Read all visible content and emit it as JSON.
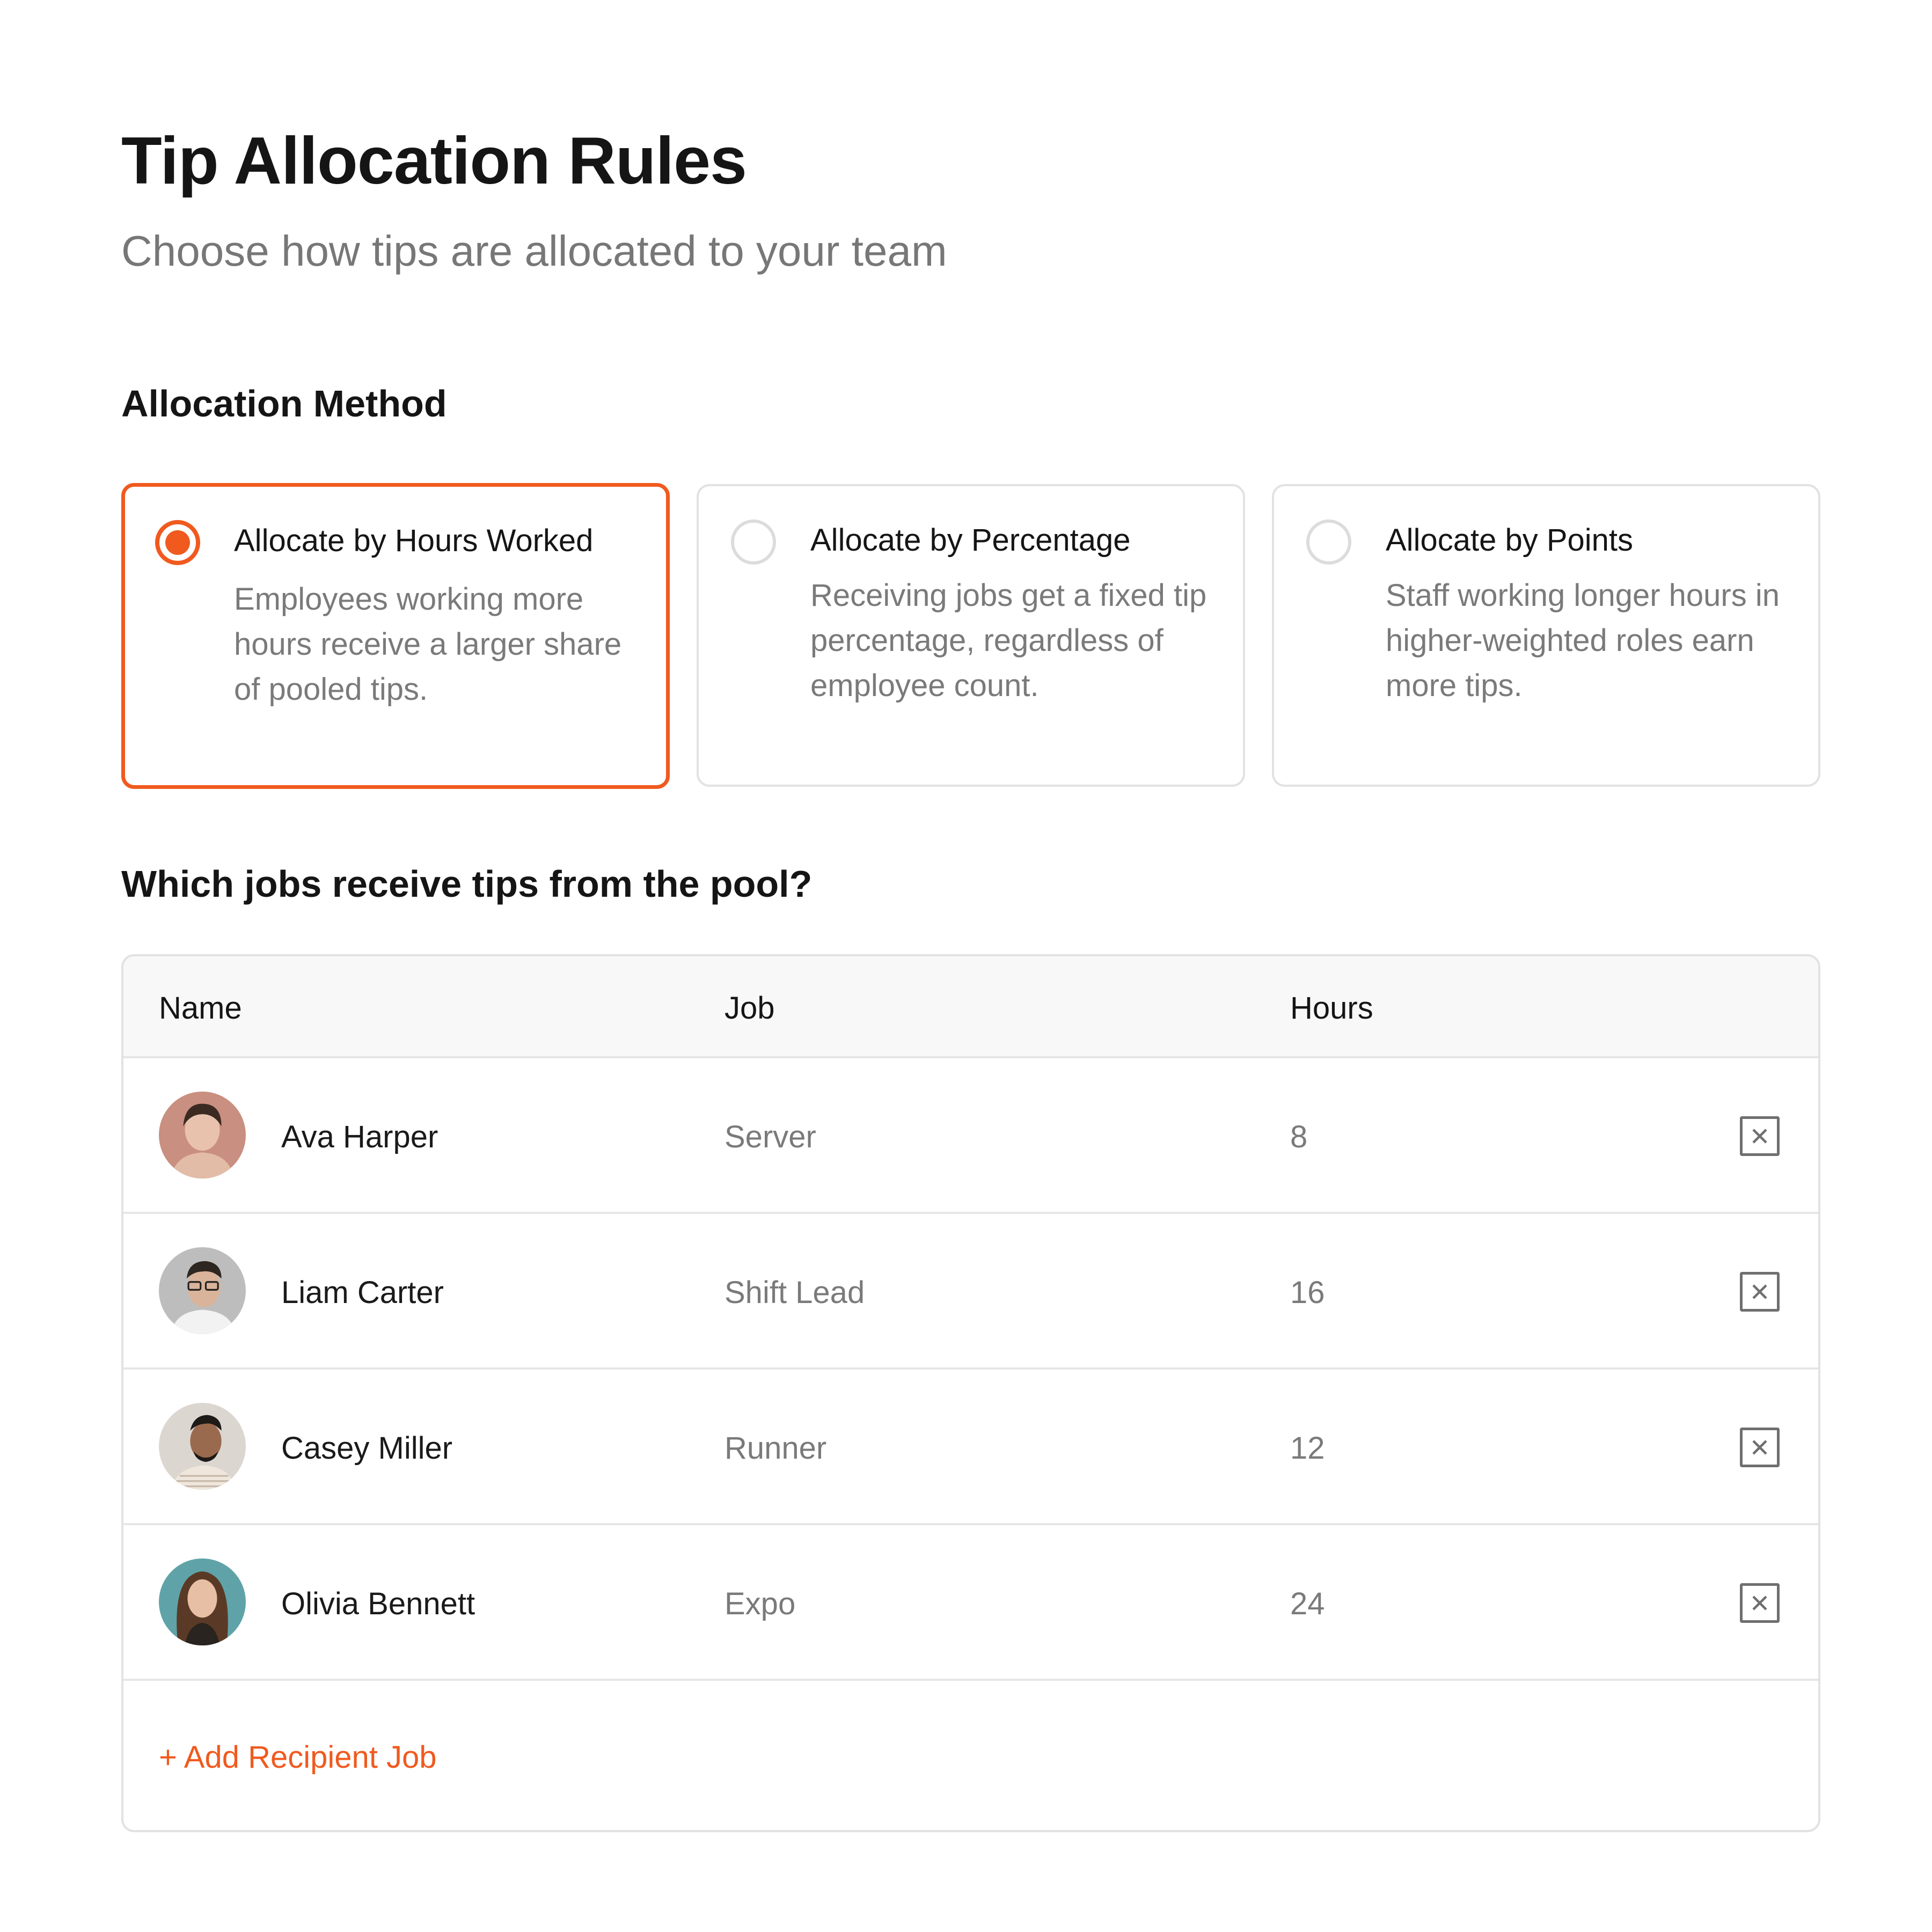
{
  "header": {
    "title": "Tip Allocation Rules",
    "subtitle": "Choose how tips are allocated to your team"
  },
  "allocation": {
    "section_title": "Allocation Method",
    "selected_index": 0,
    "accent_color": "#f05a1f",
    "options": [
      {
        "title": "Allocate by Hours Worked",
        "description": "Employees working more hours receive a larger share of pooled tips.",
        "selected": true
      },
      {
        "title": "Allocate by Percentage",
        "description": "Receiving jobs get a fixed tip percentage, regardless of employee count.",
        "selected": false
      },
      {
        "title": "Allocate by Points",
        "description": "Staff working longer hours in higher-weighted roles earn more tips.",
        "selected": false
      }
    ]
  },
  "recipients": {
    "section_title": "Which jobs receive tips from the pool?",
    "columns": [
      "Name",
      "Job",
      "Hours"
    ],
    "rows": [
      {
        "name": "Ava Harper",
        "job": "Server",
        "hours": "8",
        "avatar_bg": "#c98f80"
      },
      {
        "name": "Liam Carter",
        "job": "Shift Lead",
        "hours": "16",
        "avatar_bg": "#b9b9b9"
      },
      {
        "name": "Casey Miller",
        "job": "Runner",
        "hours": "12",
        "avatar_bg": "#d9d4cf"
      },
      {
        "name": "Olivia Bennett",
        "job": "Expo",
        "hours": "24",
        "avatar_bg": "#5fa3a8"
      }
    ],
    "remove_icon": "close-box-icon",
    "add_label": "+ Add Recipient Job"
  }
}
